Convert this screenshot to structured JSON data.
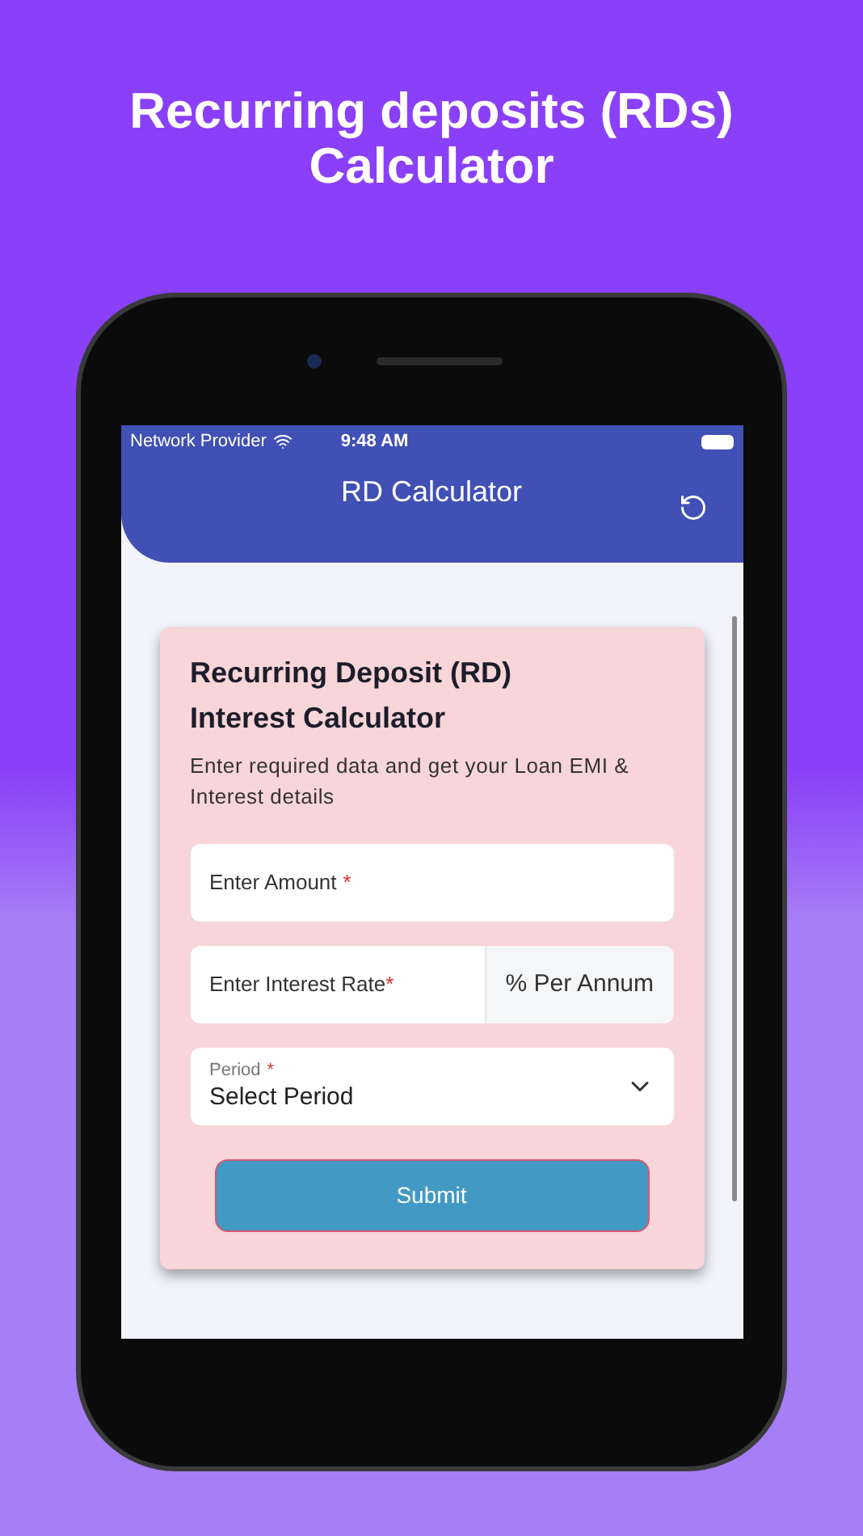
{
  "headline": "Recurring deposits (RDs) Calculator",
  "status_bar": {
    "carrier": "Network Provider",
    "time": "9:48 AM"
  },
  "app_bar": {
    "title": "RD Calculator"
  },
  "card": {
    "title": "Recurring Deposit (RD) Interest Calculator",
    "subtitle": "Enter required data and get your Loan EMI & Interest details"
  },
  "fields": [
    {
      "kind": "text",
      "placeholder": "Enter Amount",
      "required_mark": "*"
    },
    {
      "kind": "suffix",
      "placeholder": "Enter Interest Rate",
      "required_mark": "*",
      "suffix": "% Per Annum"
    },
    {
      "kind": "select",
      "label": "Period",
      "required_mark": "*",
      "value": "Select Period"
    }
  ],
  "submit": "Submit"
}
